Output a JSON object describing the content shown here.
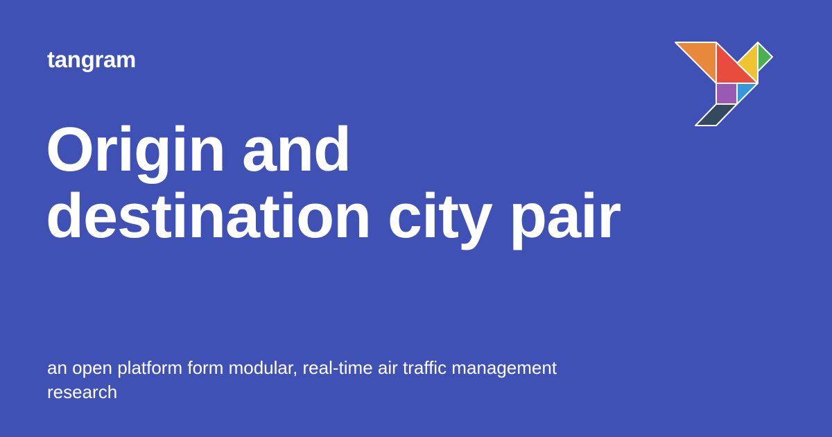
{
  "site": {
    "name": "tangram"
  },
  "page": {
    "title_line_1": "Origin and",
    "title_line_2": "destination city pair",
    "description_line_1": "an open platform form modular, real-time air traffic management",
    "description_line_2": "research"
  },
  "logo": {
    "icon": "tangram-bird-logo-icon",
    "colors": {
      "orange": "#e8883a",
      "red": "#e84c3d",
      "yellow": "#f0c330",
      "green": "#4caf50",
      "purple": "#9b59b6",
      "blue": "#3498db",
      "navy": "#34495e",
      "outline": "#ffffff"
    }
  },
  "theme": {
    "background": "#3f51b5",
    "text": "#ffffff"
  }
}
